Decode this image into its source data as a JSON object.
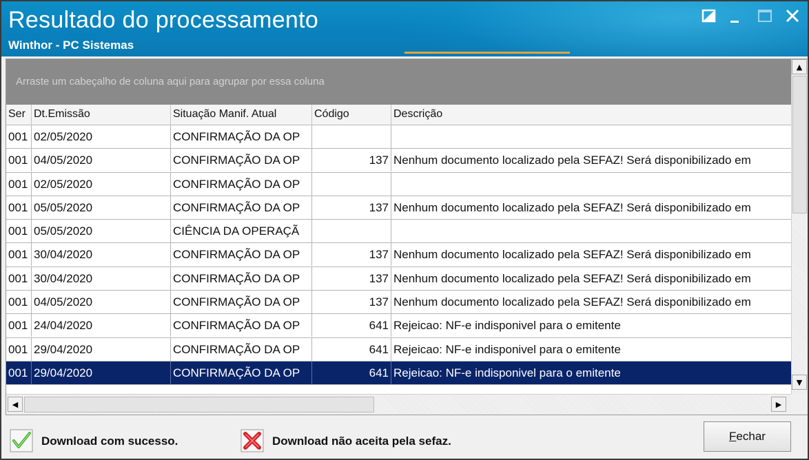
{
  "window": {
    "title": "Resultado do processamento",
    "subtitle": "Winthor - PC Sistemas"
  },
  "grid": {
    "group_hint": "Arraste um cabeçalho de coluna aqui para agrupar por essa coluna",
    "columns": [
      "Ser",
      "Dt.Emissão",
      "Situação Manif. Atual",
      "Código",
      "Descrição"
    ],
    "rows": [
      {
        "ser": "001",
        "dt": "02/05/2020",
        "situacao": "CONFIRMAÇÃO DA OP",
        "codigo": "",
        "descricao": ""
      },
      {
        "ser": "001",
        "dt": "04/05/2020",
        "situacao": "CONFIRMAÇÃO DA OP",
        "codigo": "137",
        "descricao": "Nenhum documento localizado pela SEFAZ! Será disponibilizado em"
      },
      {
        "ser": "001",
        "dt": "02/05/2020",
        "situacao": "CONFIRMAÇÃO DA OP",
        "codigo": "",
        "descricao": ""
      },
      {
        "ser": "001",
        "dt": "05/05/2020",
        "situacao": "CONFIRMAÇÃO DA OP",
        "codigo": "137",
        "descricao": "Nenhum documento localizado pela SEFAZ! Será disponibilizado em"
      },
      {
        "ser": "001",
        "dt": "05/05/2020",
        "situacao": "CIÊNCIA DA OPERAÇÃ",
        "codigo": "",
        "descricao": ""
      },
      {
        "ser": "001",
        "dt": "30/04/2020",
        "situacao": "CONFIRMAÇÃO DA OP",
        "codigo": "137",
        "descricao": "Nenhum documento localizado pela SEFAZ! Será disponibilizado em"
      },
      {
        "ser": "001",
        "dt": "30/04/2020",
        "situacao": "CONFIRMAÇÃO DA OP",
        "codigo": "137",
        "descricao": "Nenhum documento localizado pela SEFAZ! Será disponibilizado em"
      },
      {
        "ser": "001",
        "dt": "04/05/2020",
        "situacao": "CONFIRMAÇÃO DA OP",
        "codigo": "137",
        "descricao": "Nenhum documento localizado pela SEFAZ! Será disponibilizado em"
      },
      {
        "ser": "001",
        "dt": "24/04/2020",
        "situacao": "CONFIRMAÇÃO DA OP",
        "codigo": "641",
        "descricao": "Rejeicao: NF-e indisponivel para o emitente"
      },
      {
        "ser": "001",
        "dt": "29/04/2020",
        "situacao": "CONFIRMAÇÃO DA OP",
        "codigo": "641",
        "descricao": "Rejeicao: NF-e indisponivel para o emitente"
      },
      {
        "ser": "001",
        "dt": "29/04/2020",
        "situacao": "CONFIRMAÇÃO DA OP",
        "codigo": "641",
        "descricao": "Rejeicao: NF-e indisponivel para o emitente",
        "selected": true
      }
    ]
  },
  "legend": {
    "success_label": "Download com sucesso.",
    "success_icon": "check-icon",
    "fail_label": "Download não aceita pela sefaz.",
    "fail_icon": "cross-icon"
  },
  "buttons": {
    "close_first": "F",
    "close_rest": "echar"
  },
  "colors": {
    "titlebar": "#0b86c2",
    "selection": "#0a246a",
    "success": "#3fae2a",
    "fail": "#d8202a"
  }
}
